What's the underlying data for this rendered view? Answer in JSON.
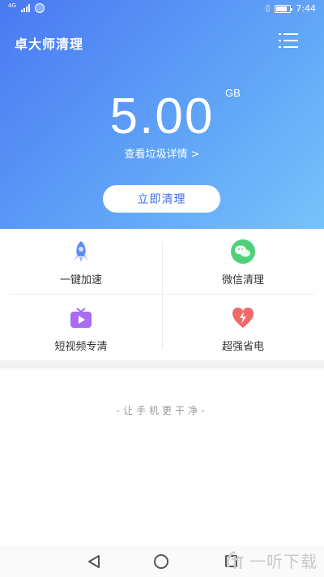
{
  "status_bar": {
    "network": "4G",
    "battery_label": "",
    "time": "7:44"
  },
  "header": {
    "app_title": "卓大师清理",
    "menu_icon": "menu-list-icon"
  },
  "storage": {
    "value": "5.00",
    "unit": "GB",
    "detail_link": "查看垃圾详情 >",
    "clean_button": "立即清理"
  },
  "features": [
    {
      "label": "一键加速",
      "icon": "rocket-icon",
      "color": "#5b8df6"
    },
    {
      "label": "微信清理",
      "icon": "wechat-icon",
      "color": "#4fd07a"
    },
    {
      "label": "短视频专清",
      "icon": "video-tv-icon",
      "color": "#a86cf5"
    },
    {
      "label": "超强省电",
      "icon": "battery-heart-icon",
      "color": "#f06a6a"
    }
  ],
  "slogan": "-让手机更干净-",
  "nav": {
    "back_icon": "back-triangle-icon",
    "home_icon": "home-circle-icon",
    "recent_icon": "recent-square-icon"
  },
  "watermark": "一听下载",
  "colors": {
    "hero_start": "#4a78f2",
    "hero_end": "#76c3fb",
    "accent": "#3d6ef0"
  }
}
